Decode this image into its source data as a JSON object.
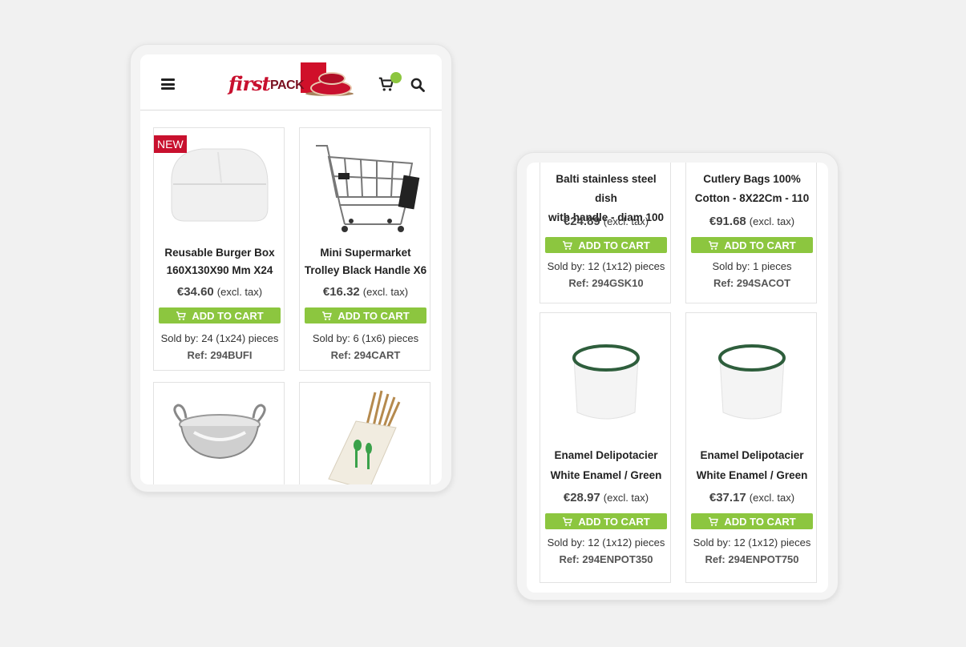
{
  "colors": {
    "accent_green": "#8cc63f",
    "brand_red": "#c8102e",
    "background": "#f1f1f1"
  },
  "header": {
    "logo_text_first": "first",
    "logo_text_pack": "PACK",
    "icons": [
      "menu-icon",
      "cart-icon",
      "search-icon"
    ]
  },
  "left_screen": {
    "products": [
      {
        "badge": "NEW",
        "title_line1": "Reusable Burger Box",
        "title_line2": "160X130X90 Mm X24",
        "price": "€34.60",
        "tax": "(excl. tax)",
        "button": "ADD TO CART",
        "sold": "Sold by: 24 (1x24) pieces",
        "ref": "Ref: 294BUFI"
      },
      {
        "title_line1": "Mini Supermarket",
        "title_line2": "Trolley Black Handle X6",
        "price": "€16.32",
        "tax": "(excl. tax)",
        "button": "ADD TO CART",
        "sold": "Sold by: 6 (1x6) pieces",
        "ref": "Ref: 294CART"
      }
    ]
  },
  "right_screen": {
    "products": [
      {
        "title_line1": "Balti stainless steel dish",
        "title_line2": "with handle - diam 100",
        "price": "€24.89",
        "tax": "(excl. tax)",
        "button": "ADD TO CART",
        "sold": "Sold by: 12 (1x12) pieces",
        "ref": "Ref: 294GSK10"
      },
      {
        "title_line1": "Cutlery Bags 100%",
        "title_line2": "Cotton - 8X22Cm - 110",
        "price": "€91.68",
        "tax": "(excl. tax)",
        "button": "ADD TO CART",
        "sold": "Sold by: 1 pieces",
        "ref": "Ref: 294SACOT"
      },
      {
        "title_line1": "Enamel Delipotacier",
        "title_line2": "White Enamel / Green",
        "price": "€28.97",
        "tax": "(excl. tax)",
        "button": "ADD TO CART",
        "sold": "Sold by: 12 (1x12) pieces",
        "ref": "Ref: 294ENPOT350"
      },
      {
        "title_line1": "Enamel Delipotacier",
        "title_line2": "White Enamel / Green",
        "price": "€37.17",
        "tax": "(excl. tax)",
        "button": "ADD TO CART",
        "sold": "Sold by: 12 (1x12) pieces",
        "ref": "Ref: 294ENPOT750"
      }
    ]
  }
}
